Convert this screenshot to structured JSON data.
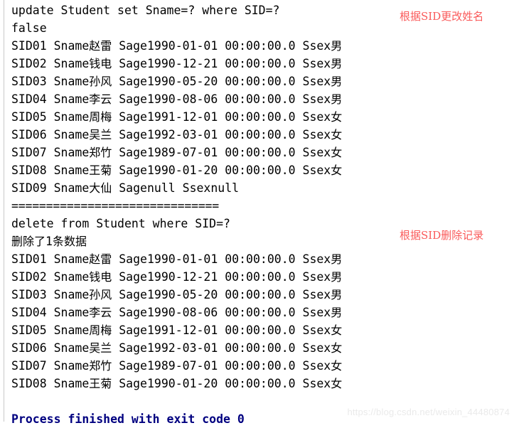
{
  "console": {
    "gutter_color": "#c9c9c9",
    "background_color": "#ffffff",
    "text_color": "#000000",
    "system_output_color": "#000080",
    "annotation_color": "#fa5a5a",
    "lines": [
      {
        "id": "sql-update",
        "text": "update Student set Sname=? where SID=?",
        "style": "plain"
      },
      {
        "id": "update-result",
        "text": "false",
        "style": "plain"
      },
      {
        "id": "row-a-1",
        "text": "SID01 Sname赵雷 Sage1990-01-01 00:00:00.0 Ssex男",
        "style": "plain"
      },
      {
        "id": "row-a-2",
        "text": "SID02 Sname钱电 Sage1990-12-21 00:00:00.0 Ssex男",
        "style": "plain"
      },
      {
        "id": "row-a-3",
        "text": "SID03 Sname孙风 Sage1990-05-20 00:00:00.0 Ssex男",
        "style": "plain"
      },
      {
        "id": "row-a-4",
        "text": "SID04 Sname李云 Sage1990-08-06 00:00:00.0 Ssex男",
        "style": "plain"
      },
      {
        "id": "row-a-5",
        "text": "SID05 Sname周梅 Sage1991-12-01 00:00:00.0 Ssex女",
        "style": "plain"
      },
      {
        "id": "row-a-6",
        "text": "SID06 Sname吴兰 Sage1992-03-01 00:00:00.0 Ssex女",
        "style": "plain"
      },
      {
        "id": "row-a-7",
        "text": "SID07 Sname郑竹 Sage1989-07-01 00:00:00.0 Ssex女",
        "style": "plain"
      },
      {
        "id": "row-a-8",
        "text": "SID08 Sname王菊 Sage1990-01-20 00:00:00.0 Ssex女",
        "style": "plain"
      },
      {
        "id": "row-a-9",
        "text": "SID09 Sname大仙 Sagenull Ssexnull",
        "style": "plain"
      },
      {
        "id": "separator",
        "text": "==============================",
        "style": "sep"
      },
      {
        "id": "sql-delete",
        "text": "delete from Student where SID=?",
        "style": "plain"
      },
      {
        "id": "delete-result",
        "text": "删除了1条数据",
        "style": "plain"
      },
      {
        "id": "row-b-1",
        "text": "SID01 Sname赵雷 Sage1990-01-01 00:00:00.0 Ssex男",
        "style": "plain"
      },
      {
        "id": "row-b-2",
        "text": "SID02 Sname钱电 Sage1990-12-21 00:00:00.0 Ssex男",
        "style": "plain"
      },
      {
        "id": "row-b-3",
        "text": "SID03 Sname孙风 Sage1990-05-20 00:00:00.0 Ssex男",
        "style": "plain"
      },
      {
        "id": "row-b-4",
        "text": "SID04 Sname李云 Sage1990-08-06 00:00:00.0 Ssex男",
        "style": "plain"
      },
      {
        "id": "row-b-5",
        "text": "SID05 Sname周梅 Sage1991-12-01 00:00:00.0 Ssex女",
        "style": "plain"
      },
      {
        "id": "row-b-6",
        "text": "SID06 Sname吴兰 Sage1992-03-01 00:00:00.0 Ssex女",
        "style": "plain"
      },
      {
        "id": "row-b-7",
        "text": "SID07 Sname郑竹 Sage1989-07-01 00:00:00.0 Ssex女",
        "style": "plain"
      },
      {
        "id": "row-b-8",
        "text": "SID08 Sname王菊 Sage1990-01-20 00:00:00.0 Ssex女",
        "style": "plain"
      },
      {
        "id": "spacer-1",
        "text": " ",
        "style": "blank"
      },
      {
        "id": "process-finished",
        "text": "Process finished with exit code 0",
        "style": "sysout"
      }
    ]
  },
  "annotations": {
    "update": "根据SID更改姓名",
    "delete": "根据SID删除记录"
  },
  "watermark": {
    "text": "https://blog.csdn.net/weixin_44480874"
  }
}
